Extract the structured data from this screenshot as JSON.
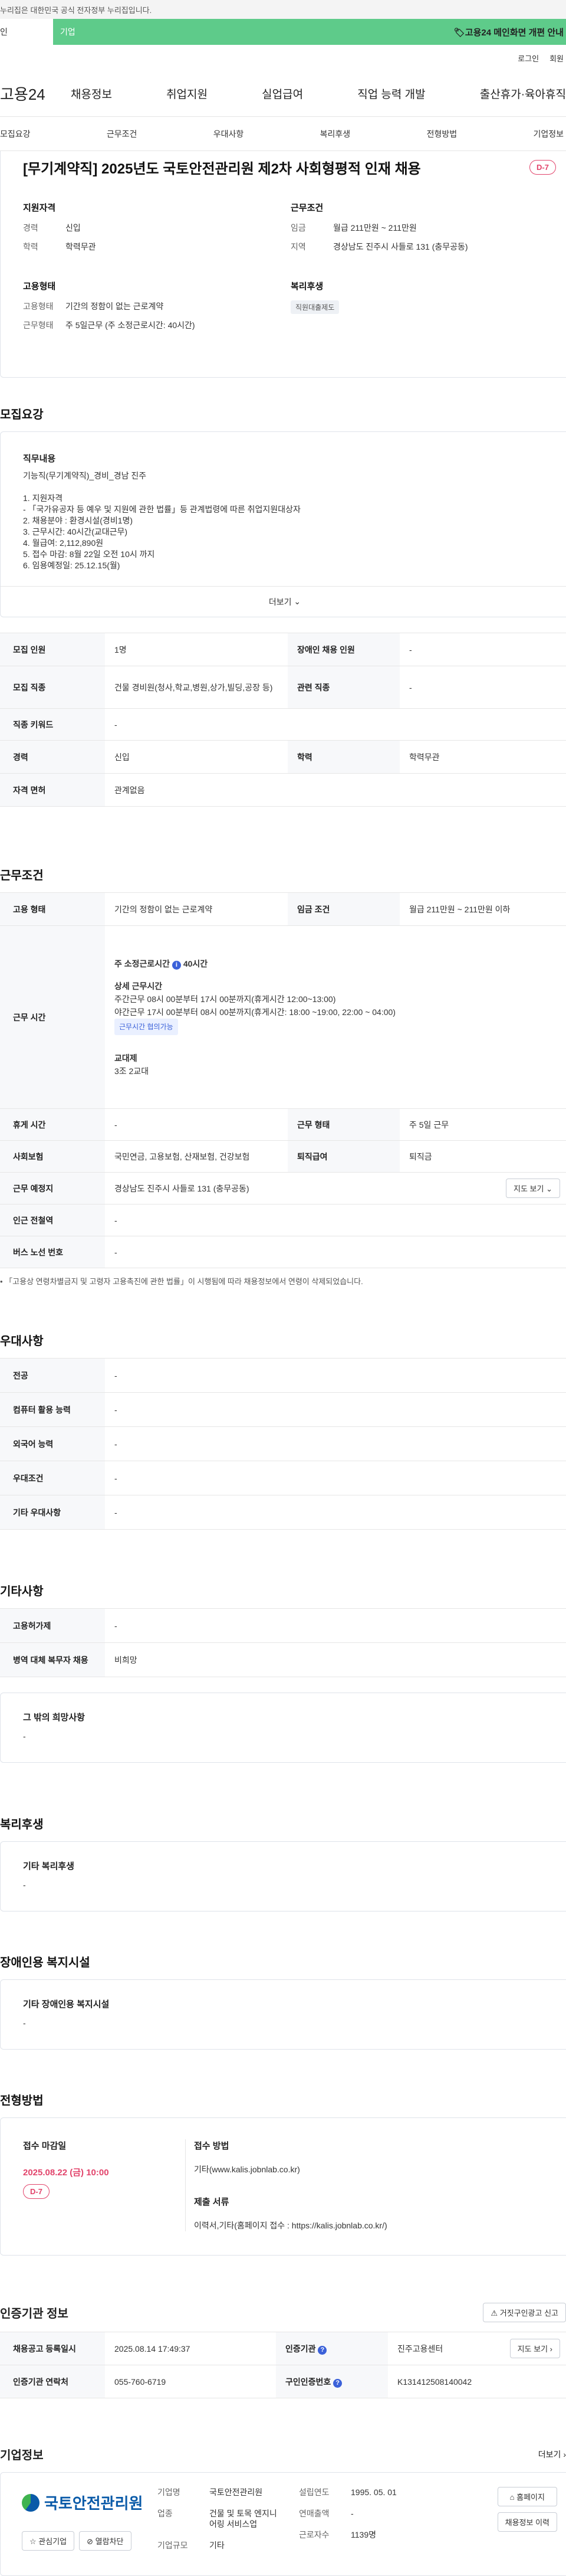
{
  "banner": "누리집은 대한민국 공식 전자정부 누리집입니다.",
  "tabs": {
    "t1": "인",
    "t2": "기업",
    "ad": "고용24 메인화면 개편 안내"
  },
  "util": {
    "login": "로그인",
    "join": "회원"
  },
  "gnb": {
    "logo": "고용24",
    "menu": [
      "채용정보",
      "취업지원",
      "실업급여",
      "직업 능력 개발",
      "출산휴가·육아휴직"
    ]
  },
  "subtabs": [
    "모집요강",
    "근무조건",
    "우대사항",
    "복리후생",
    "전형방법",
    "기업정보"
  ],
  "job": {
    "title": "[무기계약직] 2025년도 국토안전관리원 제2차 사회형평적 인재 채용",
    "dday": "D-7",
    "qual_title": "지원자격",
    "qual_career_k": "경력",
    "qual_career_v": "신입",
    "qual_edu_k": "학력",
    "qual_edu_v": "학력무관",
    "cond_title": "근무조건",
    "cond_wage_k": "임금",
    "cond_wage_v": "월급 211만원 ~ 211만원",
    "cond_loc_k": "지역",
    "cond_loc_v": "경상남도 진주시 사들로 131 (충무공동)",
    "emp_title": "고용형태",
    "emp_type_k": "고용형태",
    "emp_type_v": "기간의 정함이 없는 근로계약",
    "emp_week_k": "근무형태",
    "emp_week_v": "주 5일근무 (주 소정근로시간: 40시간)",
    "welfare_title": "복리후생",
    "welfare_chip": "직원대출제도"
  },
  "recruit": {
    "heading": "모집요강",
    "desc_title": "직무내용",
    "desc_body": "기능직(무기계약직)_경비_경남 진주\n\n1. 지원자격\n - 「국가유공자 등 예우 및 지원에 관한 법률」등 관계법령에 따른 취업지원대상자\n2. 채용분야 : 환경시설(경비1명)\n3. 근무시간: 40시간(교대근무)\n4. 월급여: 2,112,890원\n5. 접수 마감: 8월 22일 오전 10시 까지\n6. 임용예정일: 25.12.15(월)",
    "more": "더보기",
    "rows": {
      "r1k1": "모집 인원",
      "r1v1": "1명",
      "r1k2": "장애인 채용 인원",
      "r1v2": "-",
      "r2k1": "모집 직종",
      "r2v1": "건물 경비원(청사,학교,병원,상가,빌딩,공장 등)",
      "r2k2": "관련 직종",
      "r2v2": "-",
      "r3k1": "직종 키워드",
      "r3v1": "-",
      "r4k1": "경력",
      "r4v1": "신입",
      "r4k2": "학력",
      "r4v2": "학력무관",
      "r5k1": "자격 면허",
      "r5v1": "관계없음"
    }
  },
  "work": {
    "heading": "근무조건",
    "emp_k": "고용 형태",
    "emp_v": "기간의 정함이 없는 근로계약",
    "wage_k": "임금 조건",
    "wage_v": "월급 211만원 ~ 211만원 이하",
    "time_k": "근무 시간",
    "time_week": "주 소정근로시간",
    "time_week_hours": "40시간",
    "time_detail_title": "상세 근무시간",
    "time_day": "주간근무 08시 00분부터 17시 00분까지(휴게시간 12:00~13:00)",
    "time_night": "야간근무 17시 00분부터 08시 00분까지(휴게시간: 18:00 ~19:00, 22:00 ~ 04:00)",
    "time_chip": "근무시간 협의가능",
    "shift_title": "교대제",
    "shift_v": "3조 2교대",
    "rest_k": "휴게 시간",
    "rest_v": "-",
    "form_k": "근무 형태",
    "form_v": "주 5일 근무",
    "ins_k": "사회보험",
    "ins_v": "국민연금, 고용보험, 산재보험, 건강보험",
    "ret_k": "퇴직급여",
    "ret_v": "퇴직금",
    "place_k": "근무 예정지",
    "place_v": "경상남도 진주시 사들로 131 (충무공동)",
    "map_btn": "지도 보기",
    "sub_k": "인근 전철역",
    "sub_v": "-",
    "bus_k": "버스 노선 번호",
    "bus_v": "-",
    "note": "「고용상 연령차별금지 및 고령자 고용촉진에 관한 법률」이 시행됨에 따라 채용정보에서 연령이 삭제되었습니다."
  },
  "pref": {
    "heading": "우대사항",
    "rows": [
      {
        "k": "전공",
        "v": "-"
      },
      {
        "k": "컴퓨터 활용 능력",
        "v": "-"
      },
      {
        "k": "외국어 능력",
        "v": "-"
      },
      {
        "k": "우대조건",
        "v": "-"
      },
      {
        "k": "기타 우대사항",
        "v": "-"
      }
    ]
  },
  "etc": {
    "heading": "기타사항",
    "r1k": "고용허가제",
    "r1v": "-",
    "r2k": "병역 대체 복무자 채용",
    "r2v": "비희망",
    "box_title": "그 밖의 희망사항",
    "box_v": "-"
  },
  "welfare": {
    "heading": "복리후생",
    "box_title": "기타 복리후생",
    "box_v": "-"
  },
  "disabled": {
    "heading": "장애인용 복지시설",
    "box_title": "기타 장애인용 복지시설",
    "box_v": "-"
  },
  "process": {
    "heading": "전형방법",
    "deadline_title": "접수 마감일",
    "deadline": "2025.08.22 (금) 10:00",
    "dday": "D-7",
    "method_title": "접수 방법",
    "method_v": "기타(www.kalis.jobnlab.co.kr)",
    "doc_title": "제출 서류",
    "doc_v": "이력서,기타(홈페이지 접수 : https://kalis.jobnlab.co.kr/)"
  },
  "cert": {
    "heading": "인증기관 정보",
    "report_btn": "거짓구인광고 신고",
    "r1k1": "채용공고 등록일시",
    "r1v1": "2025.08.14 17:49:37",
    "r1k2": "인증기관",
    "r1v2": "진주고용센터",
    "map_btn": "지도 보기",
    "r2k1": "인증기관 연락처",
    "r2v1": "055-760-6719",
    "r2k2": "구인인증번호",
    "r2v2": "K131412508140042"
  },
  "company": {
    "heading": "기업정보",
    "more": "더보기",
    "name": "국토안전관리원",
    "fav_btn": "관심기업",
    "follow_btn": "열람차단",
    "k_name": "기업명",
    "v_name": "국토안전관리원",
    "k_ind": "업종",
    "v_ind": "건물 및 토목 엔지니어링 서비스업",
    "k_size": "기업규모",
    "v_size": "기타",
    "k_est": "설립연도",
    "v_est": "1995. 05. 01",
    "k_sales": "연매출액",
    "v_sales": "-",
    "k_emp": "근로자수",
    "v_emp": "1139명",
    "home_btn": "홈페이지",
    "list_btn": "채용정보 이력"
  }
}
